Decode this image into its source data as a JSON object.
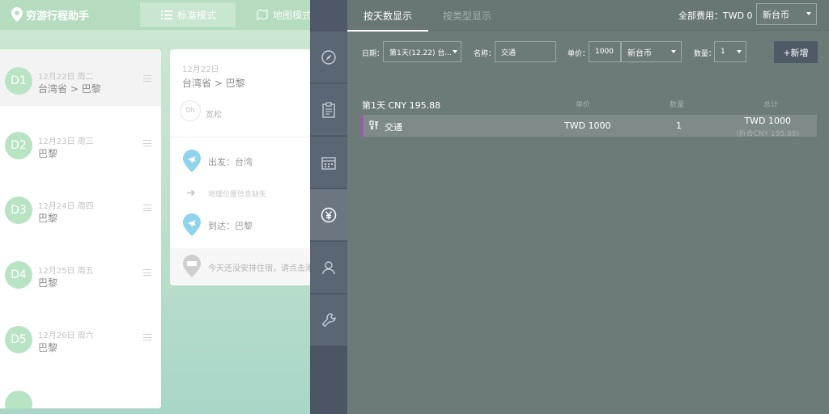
{
  "bg_app": {
    "logo_text": "穷游行程助手",
    "mode_tabs": [
      "标准模式",
      "地图模式"
    ],
    "days": [
      {
        "id": "D1",
        "date": "12月22日 周二",
        "place": "台湾省 > 巴黎",
        "active": true
      },
      {
        "id": "D2",
        "date": "12月23日 周三",
        "place": "巴黎",
        "active": false
      },
      {
        "id": "D3",
        "date": "12月24日 周四",
        "place": "巴黎",
        "active": false
      },
      {
        "id": "D4",
        "date": "12月25日 周五",
        "place": "巴黎",
        "active": false
      },
      {
        "id": "D5",
        "date": "12月26日 周六",
        "place": "巴黎",
        "active": false
      }
    ],
    "detail": {
      "date": "12月22日",
      "route": "台湾省 > 巴黎",
      "hours": "0h",
      "pace": "宽松",
      "depart": "出发：台湾",
      "missing": "地理位置信息缺失",
      "arrive": "到达：巴黎",
      "hotel_hint": "今天还没安排住宿，请点击添加"
    }
  },
  "sidebar": {
    "items": [
      "compass-icon",
      "clipboard-icon",
      "calendar-icon",
      "yen-icon",
      "user-icon",
      "wrench-icon"
    ],
    "active_index": 3
  },
  "main": {
    "tabs": [
      "按天数显示",
      "按类型显示"
    ],
    "total_label": "全部费用：TWD 0",
    "total_currency": "新台币",
    "form": {
      "date_label": "日期：",
      "date_value": "第1天(12.22) 台...",
      "name_label": "名称：",
      "name_value": "交通",
      "price_label": "单价：",
      "price_value": "1000",
      "price_currency": "新台币",
      "qty_label": "数量：",
      "qty_value": "1",
      "add_label": "+新增"
    },
    "table": {
      "day_summary": "第1天 CNY 195.88",
      "col_price": "单价",
      "col_qty": "数量",
      "col_total": "总计",
      "row": {
        "name": "交通",
        "price": "TWD 1000",
        "qty": "1",
        "total": "TWD 1000",
        "total_cny": "(折合CNY 195.88)"
      }
    }
  },
  "colors": {
    "accent": "#9b59b6",
    "panel": "#6c7a78",
    "sidebar": "#4b5563"
  }
}
